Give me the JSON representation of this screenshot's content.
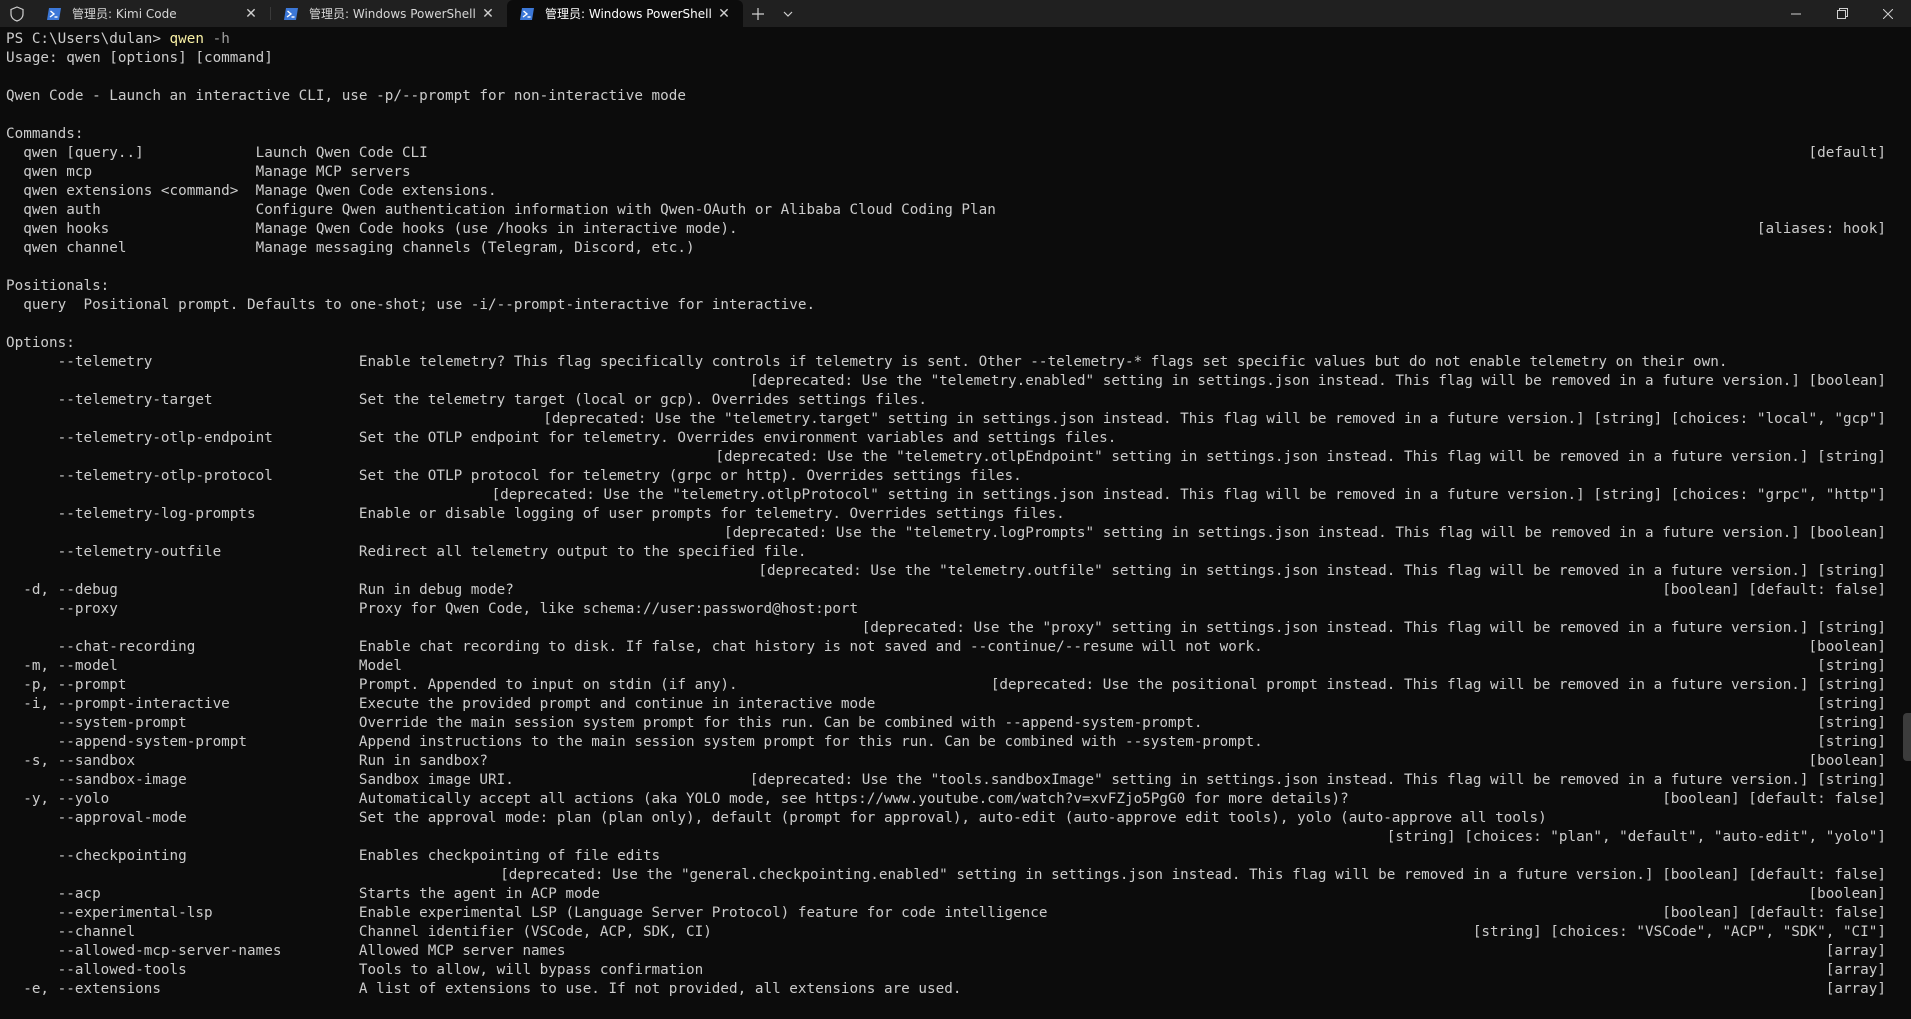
{
  "tabs": [
    {
      "label": "管理员: Kimi Code",
      "active": false
    },
    {
      "label": "管理员: Windows PowerShell",
      "active": false
    },
    {
      "label": "管理员: Windows PowerShell",
      "active": true
    }
  ],
  "colors": {
    "background": "#0c0c0c",
    "text": "#cccccc",
    "command": "#f9f1a5",
    "tabbar": "#202020",
    "powershell_icon": "#3c78d8"
  },
  "prompt": {
    "path": "PS C:\\Users\\dulan> ",
    "command": "qwen",
    "args": " -h"
  },
  "lines": [
    {
      "l": "Usage: qwen [options] [command]",
      "r": ""
    },
    {
      "l": "",
      "r": ""
    },
    {
      "l": "Qwen Code - Launch an interactive CLI, use -p/--prompt for non-interactive mode",
      "r": ""
    },
    {
      "l": "",
      "r": ""
    },
    {
      "l": "Commands:",
      "r": ""
    },
    {
      "l": "  qwen [query..]             Launch Qwen Code CLI",
      "r": "[default]"
    },
    {
      "l": "  qwen mcp                   Manage MCP servers",
      "r": ""
    },
    {
      "l": "  qwen extensions <command>  Manage Qwen Code extensions.",
      "r": ""
    },
    {
      "l": "  qwen auth                  Configure Qwen authentication information with Qwen-OAuth or Alibaba Cloud Coding Plan",
      "r": ""
    },
    {
      "l": "  qwen hooks                 Manage Qwen Code hooks (use /hooks in interactive mode).",
      "r": "[aliases: hook]"
    },
    {
      "l": "  qwen channel               Manage messaging channels (Telegram, Discord, etc.)",
      "r": ""
    },
    {
      "l": "",
      "r": ""
    },
    {
      "l": "Positionals:",
      "r": ""
    },
    {
      "l": "  query  Positional prompt. Defaults to one-shot; use -i/--prompt-interactive for interactive.",
      "r": ""
    },
    {
      "l": "",
      "r": ""
    },
    {
      "l": "Options:",
      "r": ""
    },
    {
      "l": "      --telemetry                        Enable telemetry? This flag specifically controls if telemetry is sent. Other --telemetry-* flags set specific values but do not enable telemetry on their own.",
      "r": ""
    },
    {
      "l": "",
      "r": "[deprecated: Use the \"telemetry.enabled\" setting in settings.json instead. This flag will be removed in a future version.] [boolean]"
    },
    {
      "l": "      --telemetry-target                 Set the telemetry target (local or gcp). Overrides settings files.",
      "r": ""
    },
    {
      "l": "",
      "r": "[deprecated: Use the \"telemetry.target\" setting in settings.json instead. This flag will be removed in a future version.] [string] [choices: \"local\", \"gcp\"]"
    },
    {
      "l": "      --telemetry-otlp-endpoint          Set the OTLP endpoint for telemetry. Overrides environment variables and settings files.",
      "r": ""
    },
    {
      "l": "",
      "r": "[deprecated: Use the \"telemetry.otlpEndpoint\" setting in settings.json instead. This flag will be removed in a future version.] [string]"
    },
    {
      "l": "      --telemetry-otlp-protocol          Set the OTLP protocol for telemetry (grpc or http). Overrides settings files.",
      "r": ""
    },
    {
      "l": "",
      "r": "[deprecated: Use the \"telemetry.otlpProtocol\" setting in settings.json instead. This flag will be removed in a future version.] [string] [choices: \"grpc\", \"http\"]"
    },
    {
      "l": "      --telemetry-log-prompts            Enable or disable logging of user prompts for telemetry. Overrides settings files.",
      "r": ""
    },
    {
      "l": "",
      "r": "[deprecated: Use the \"telemetry.logPrompts\" setting in settings.json instead. This flag will be removed in a future version.] [boolean]"
    },
    {
      "l": "      --telemetry-outfile                Redirect all telemetry output to the specified file.",
      "r": ""
    },
    {
      "l": "",
      "r": "[deprecated: Use the \"telemetry.outfile\" setting in settings.json instead. This flag will be removed in a future version.] [string]"
    },
    {
      "l": "  -d, --debug                            Run in debug mode?",
      "r": "[boolean] [default: false]"
    },
    {
      "l": "      --proxy                            Proxy for Qwen Code, like schema://user:password@host:port",
      "r": ""
    },
    {
      "l": "",
      "r": "[deprecated: Use the \"proxy\" setting in settings.json instead. This flag will be removed in a future version.] [string]"
    },
    {
      "l": "      --chat-recording                   Enable chat recording to disk. If false, chat history is not saved and --continue/--resume will not work.",
      "r": "[boolean]"
    },
    {
      "l": "  -m, --model                            Model",
      "r": "[string]"
    },
    {
      "l": "  -p, --prompt                           Prompt. Appended to input on stdin (if any).",
      "r": "[deprecated: Use the positional prompt instead. This flag will be removed in a future version.] [string]"
    },
    {
      "l": "  -i, --prompt-interactive               Execute the provided prompt and continue in interactive mode",
      "r": "[string]"
    },
    {
      "l": "      --system-prompt                    Override the main session system prompt for this run. Can be combined with --append-system-prompt.",
      "r": "[string]"
    },
    {
      "l": "      --append-system-prompt             Append instructions to the main session system prompt for this run. Can be combined with --system-prompt.",
      "r": "[string]"
    },
    {
      "l": "  -s, --sandbox                          Run in sandbox?",
      "r": "[boolean]"
    },
    {
      "l": "      --sandbox-image                    Sandbox image URI.",
      "r": "[deprecated: Use the \"tools.sandboxImage\" setting in settings.json instead. This flag will be removed in a future version.] [string]"
    },
    {
      "l": "  -y, --yolo                             Automatically accept all actions (aka YOLO mode, see https://www.youtube.com/watch?v=xvFZjo5PgG0 for more details)?",
      "r": "[boolean] [default: false]"
    },
    {
      "l": "      --approval-mode                    Set the approval mode: plan (plan only), default (prompt for approval), auto-edit (auto-approve edit tools), yolo (auto-approve all tools)",
      "r": ""
    },
    {
      "l": "",
      "r": "[string] [choices: \"plan\", \"default\", \"auto-edit\", \"yolo\"]"
    },
    {
      "l": "      --checkpointing                    Enables checkpointing of file edits",
      "r": ""
    },
    {
      "l": "",
      "r": "[deprecated: Use the \"general.checkpointing.enabled\" setting in settings.json instead. This flag will be removed in a future version.] [boolean] [default: false]"
    },
    {
      "l": "      --acp                              Starts the agent in ACP mode",
      "r": "[boolean]"
    },
    {
      "l": "      --experimental-lsp                 Enable experimental LSP (Language Server Protocol) feature for code intelligence",
      "r": "[boolean] [default: false]"
    },
    {
      "l": "      --channel                          Channel identifier (VSCode, ACP, SDK, CI)",
      "r": "[string] [choices: \"VSCode\", \"ACP\", \"SDK\", \"CI\"]"
    },
    {
      "l": "      --allowed-mcp-server-names         Allowed MCP server names",
      "r": "[array]"
    },
    {
      "l": "      --allowed-tools                    Tools to allow, will bypass confirmation",
      "r": "[array]"
    },
    {
      "l": "  -e, --extensions                       A list of extensions to use. If not provided, all extensions are used.",
      "r": "[array]"
    }
  ]
}
